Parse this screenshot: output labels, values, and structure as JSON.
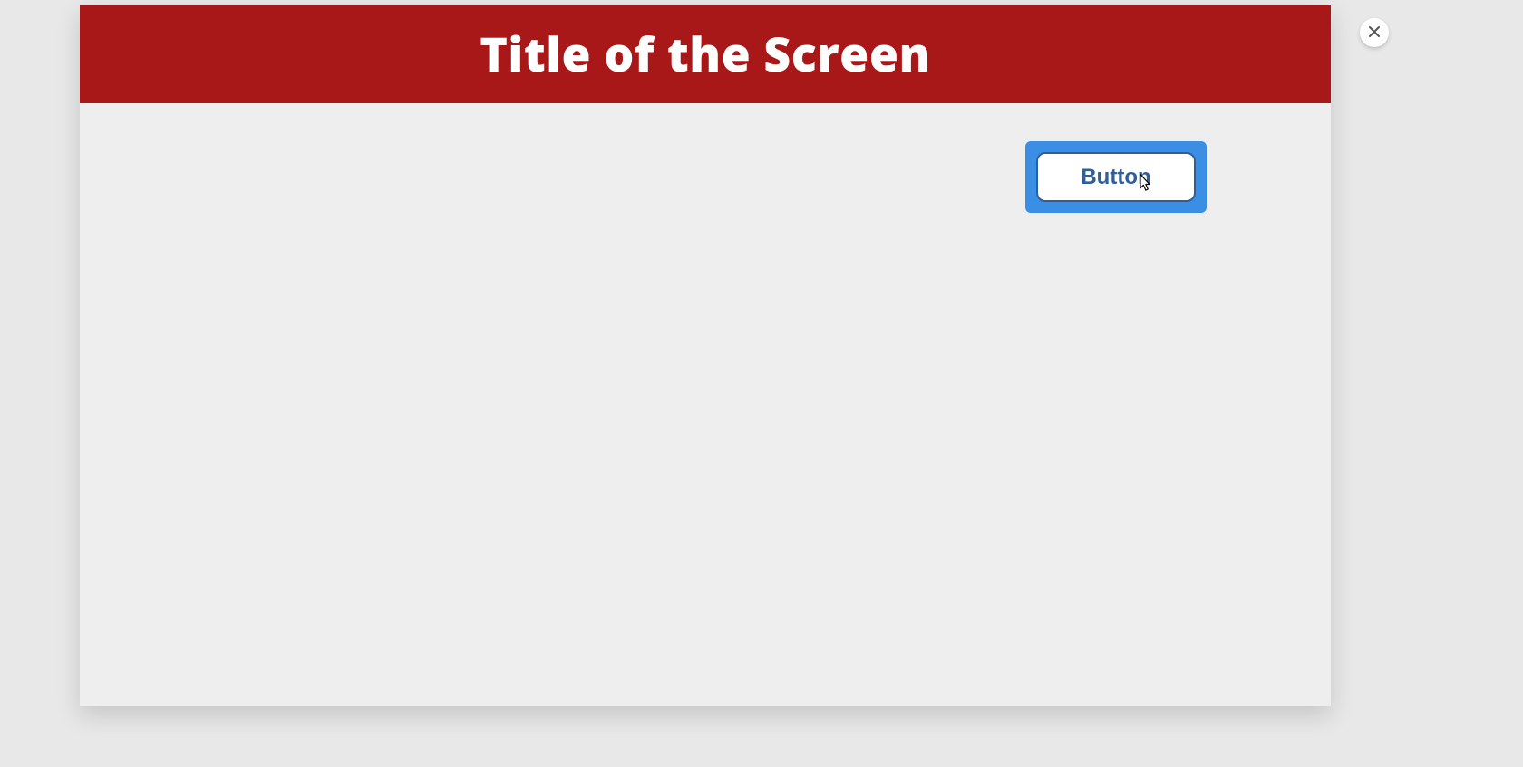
{
  "header": {
    "title": "Title of the Screen"
  },
  "content": {
    "button_label": "Button"
  },
  "controls": {
    "close_label": "Close"
  },
  "colors": {
    "header_bg": "#a81818",
    "highlight": "#3a8fe4",
    "button_border": "#2f5f9a"
  }
}
